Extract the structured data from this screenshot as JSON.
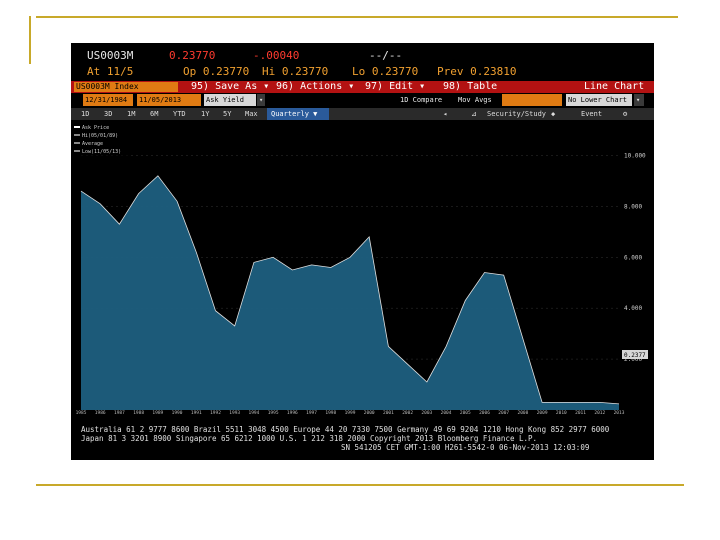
{
  "header": {
    "ticker": "US0003M",
    "last": "0.23770",
    "change": "-.00040",
    "time": "--/--",
    "at_date": "At 11/5",
    "open": "Op 0.23770",
    "high": "Hi 0.23770",
    "low": "Lo 0.23770",
    "prev": "Prev 0.23810"
  },
  "toolbar": {
    "security": "US0003M Index",
    "save_as": "95) Save As ▾",
    "actions": "96) Actions ▾",
    "edit": "97) Edit ▾",
    "table": "98) Table",
    "chart_type": "Line Chart"
  },
  "controls": {
    "start_date": "12/31/1984",
    "end_date": "11/05/2013",
    "field": "Ask Yield",
    "compare": "1D Compare",
    "mov_avgs": "Mov Avgs",
    "lower_chart": "No Lower Chart"
  },
  "timeframes": [
    "1D",
    "3D",
    "1M",
    "6M",
    "YTD",
    "1Y",
    "5Y",
    "Max"
  ],
  "period": "Quarterly ▼",
  "security_study": "Security/Study",
  "event": "Event",
  "legend": [
    "Ask Price",
    "Hi(05/01/89)",
    "Average",
    "Low(11/05/13)"
  ],
  "chart_data": {
    "type": "area",
    "x": [
      1985,
      1986,
      1987,
      1988,
      1989,
      1990,
      1991,
      1992,
      1993,
      1994,
      1995,
      1996,
      1997,
      1998,
      1999,
      2000,
      2001,
      2002,
      2003,
      2004,
      2005,
      2006,
      2007,
      2008,
      2009,
      2010,
      2011,
      2012,
      2013
    ],
    "values": [
      8.6,
      8.1,
      7.3,
      8.5,
      9.2,
      8.2,
      6.2,
      3.9,
      3.3,
      5.8,
      6.0,
      5.5,
      5.7,
      5.6,
      6.0,
      6.8,
      2.5,
      1.8,
      1.1,
      2.5,
      4.3,
      5.4,
      5.3,
      2.8,
      0.3,
      0.3,
      0.3,
      0.3,
      0.24
    ],
    "y_ticks": [
      "10.000",
      "8.000",
      "6.000",
      "4.000",
      "2.000"
    ],
    "y_tick_values": [
      10,
      8,
      6,
      4,
      2
    ],
    "ylim": [
      0,
      11
    ],
    "x_tick_labels": [
      "1985",
      "1986",
      "1987",
      "1988",
      "1989",
      "1990",
      "1991",
      "1992",
      "1993",
      "1994",
      "1995",
      "1996",
      "1997",
      "1998",
      "1999",
      "2000",
      "2001",
      "2002",
      "2003",
      "2004",
      "2005",
      "2006",
      "2007",
      "2008",
      "2009",
      "2010",
      "2011",
      "2012",
      "2013"
    ],
    "last_label": "0.2377",
    "fill_color": "#1d5f80",
    "line_color": "#e0e0e0"
  },
  "footer": {
    "line1": "Australia 61 2 9777 8600 Brazil 5511 3048 4500 Europe 44 20 7330 7500 Germany 49 69 9204 1210 Hong Kong 852 2977 6000",
    "line2": "Japan 81 3 3201 8900        Singapore 65 6212 1000    U.S. 1 212 318 2000     Copyright 2013 Bloomberg Finance L.P.",
    "line3": "SN 541205 CET  GMT-1:00 H261-5542-0 06-Nov-2013 12:03:09"
  }
}
